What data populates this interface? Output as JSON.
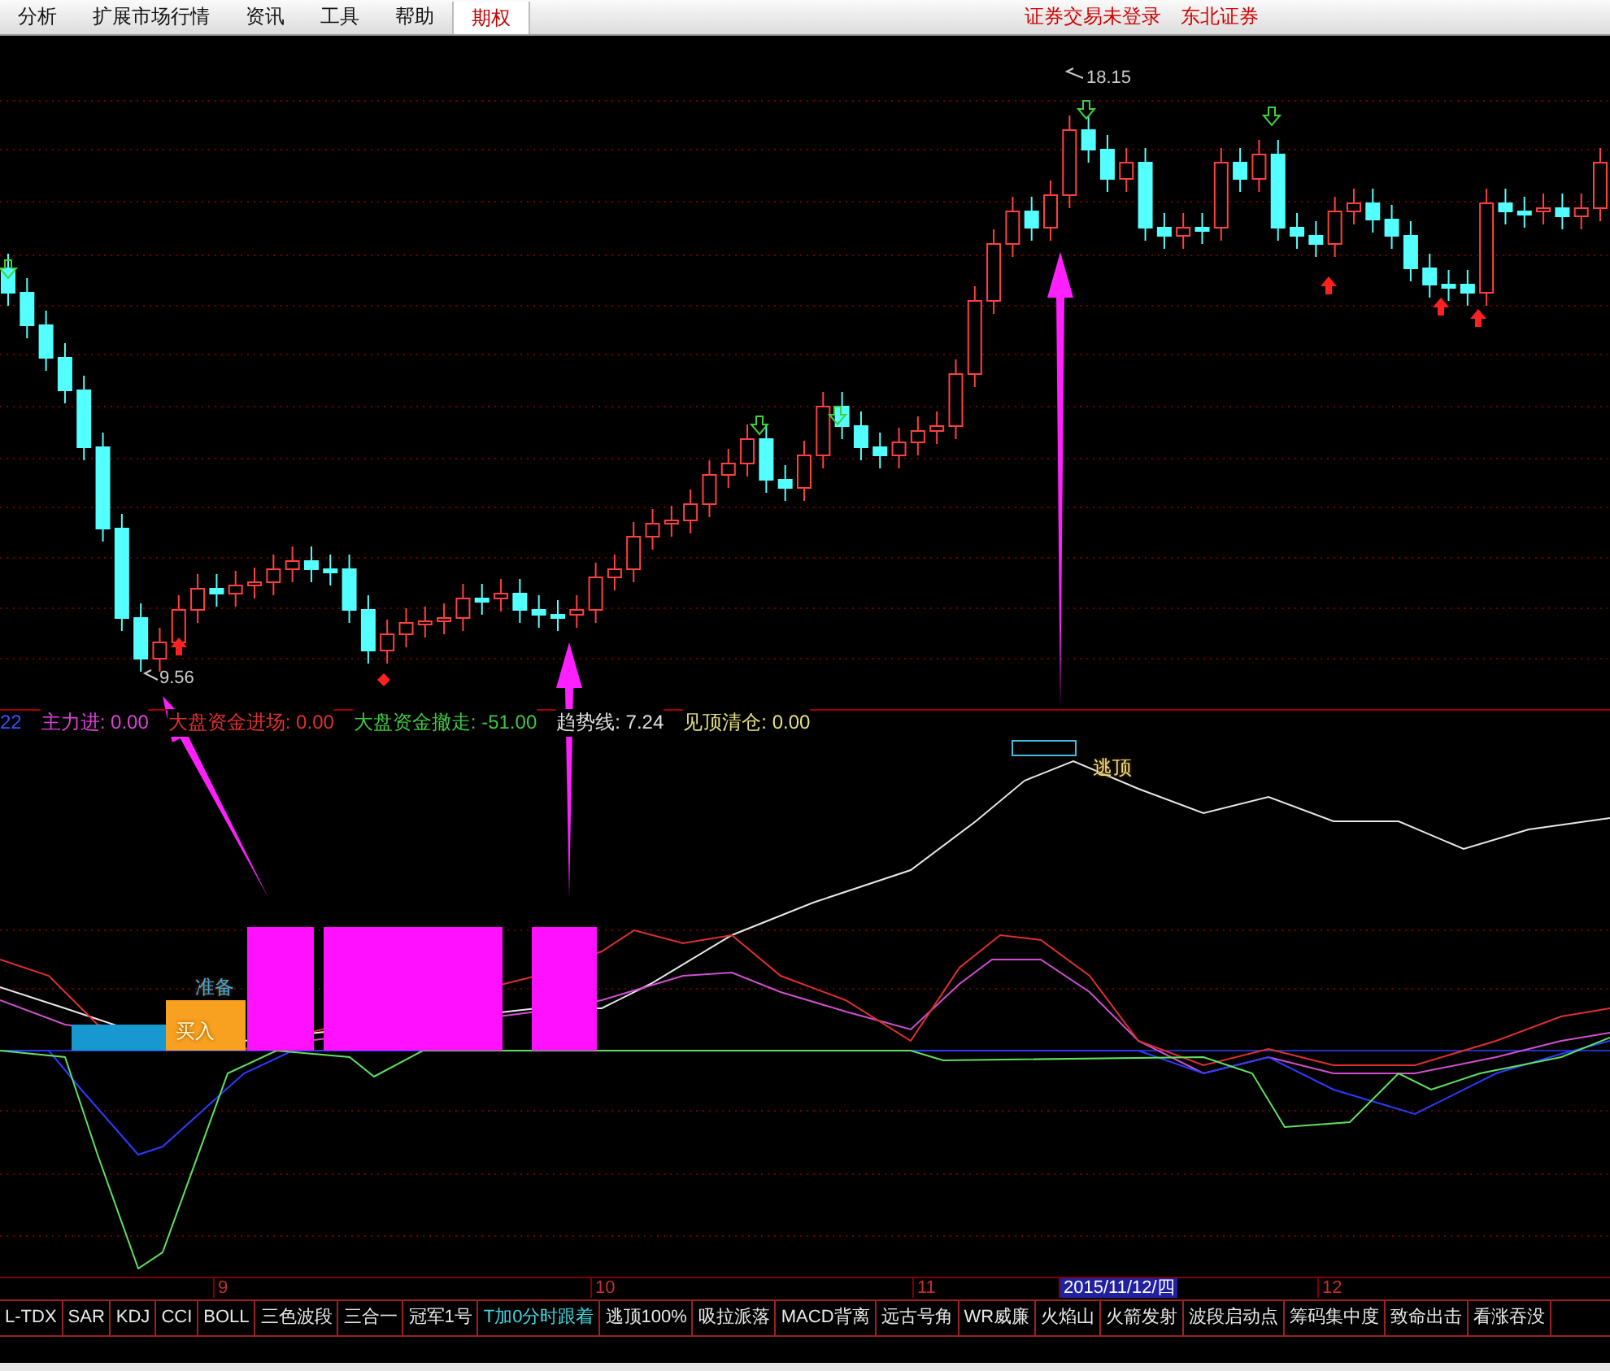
{
  "menu": {
    "items": [
      {
        "label": "分析",
        "selected": false
      },
      {
        "label": "扩展市场行情",
        "selected": false
      },
      {
        "label": "资讯",
        "selected": false
      },
      {
        "label": "工具",
        "selected": false
      },
      {
        "label": "帮助",
        "selected": false
      },
      {
        "label": "期权",
        "selected": true
      }
    ],
    "links": [
      "证券交易未登录",
      "东北证券"
    ]
  },
  "price_labels": [
    {
      "label": "18.15",
      "kind": "high"
    },
    {
      "label": "9.56",
      "kind": "low"
    }
  ],
  "legend": [
    {
      "label": "22",
      "color": "#3355ff"
    },
    {
      "label": "主力进: 0.00",
      "color": "#e040e0"
    },
    {
      "label": "大盘资金进场: 0.00",
      "color": "#e03030"
    },
    {
      "label": "大盘资金撤走: -51.00",
      "color": "#40c840"
    },
    {
      "label": "趋势线: 7.24",
      "color": "#e0e0e0"
    },
    {
      "label": "见顶清仓: 0.00",
      "color": "#e6e080"
    }
  ],
  "signals": [
    {
      "label": "逃顶",
      "kind": "top"
    },
    {
      "label": "准备",
      "kind": "ready"
    },
    {
      "label": "买入",
      "kind": "buy"
    }
  ],
  "axis": [
    {
      "label": "9",
      "selected": false
    },
    {
      "label": "10",
      "selected": false
    },
    {
      "label": "11",
      "selected": false
    },
    {
      "label": "2015/11/12/四",
      "selected": true
    },
    {
      "label": "12",
      "selected": false
    }
  ],
  "tabs": [
    {
      "label": "L-TDX",
      "selected": false
    },
    {
      "label": "SAR",
      "selected": false
    },
    {
      "label": "KDJ",
      "selected": false
    },
    {
      "label": "CCI",
      "selected": false
    },
    {
      "label": "BOLL",
      "selected": false
    },
    {
      "label": "三色波段",
      "selected": false
    },
    {
      "label": "三合一",
      "selected": false
    },
    {
      "label": "冠军1号",
      "selected": false
    },
    {
      "label": "T加0分时跟着",
      "selected": true
    },
    {
      "label": "逃顶100%",
      "selected": false
    },
    {
      "label": "吸拉派落",
      "selected": false
    },
    {
      "label": "MACD背离",
      "selected": false
    },
    {
      "label": "远古号角",
      "selected": false
    },
    {
      "label": "WR威廉",
      "selected": false
    },
    {
      "label": "火焰山",
      "selected": false
    },
    {
      "label": "火箭发射",
      "selected": false
    },
    {
      "label": "波段启动点",
      "selected": false
    },
    {
      "label": "筹码集中度",
      "selected": false
    },
    {
      "label": "致命出击",
      "selected": false
    },
    {
      "label": "看涨吞没",
      "selected": false
    }
  ]
}
